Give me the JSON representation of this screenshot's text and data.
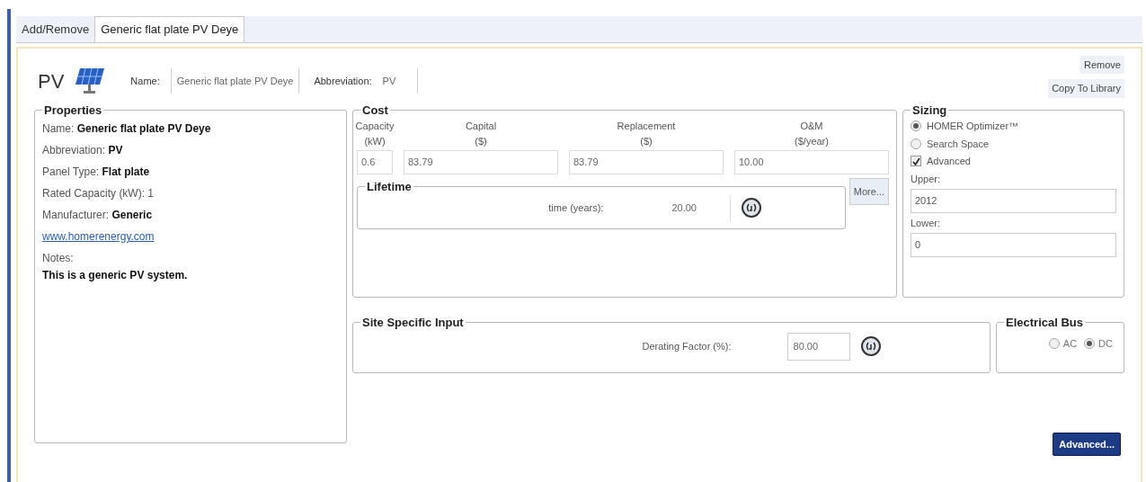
{
  "tabs": [
    {
      "label": "Add/Remove",
      "selected": false
    },
    {
      "label": "Generic flat plate PV Deye",
      "selected": true
    }
  ],
  "header": {
    "short": "PV",
    "name_label": "Name:",
    "name_value": "Generic flat plate PV Deye",
    "abbr_label": "Abbreviation:",
    "abbr_value": "PV",
    "buttons": [
      "Remove",
      "Copy To Library"
    ]
  },
  "properties": {
    "title": "Properties",
    "lines": [
      {
        "kind": "text",
        "text": "Name: **Generic flat plate PV Deye**"
      },
      {
        "kind": "text",
        "text": "Abbreviation: **PV**"
      },
      {
        "kind": "text",
        "text": "Panel Type: **Flat plate**"
      },
      {
        "kind": "text",
        "text": "Rated Capacity (kW): 1"
      },
      {
        "kind": "text",
        "text": "Manufacturer: **Generic**"
      },
      {
        "kind": "link",
        "text": "www.homerenergy.com"
      },
      {
        "kind": "text",
        "text": "Notes:"
      },
      {
        "kind": "bold",
        "text": "This is a generic PV system."
      }
    ]
  },
  "cost": {
    "title": "Cost",
    "columns": [
      {
        "label": "Capacity",
        "unit": "(kW)",
        "value": "0.6"
      },
      {
        "label": "Capital",
        "unit": "($)",
        "value": "83.79"
      },
      {
        "label": "Replacement",
        "unit": "($)",
        "value": "83.79"
      },
      {
        "label": "O&M",
        "unit": "($/year)",
        "value": "10.00"
      }
    ],
    "lifetime": {
      "title": "Lifetime",
      "label": "time (years):",
      "value": "20.00"
    },
    "more_button": "More..."
  },
  "sizing": {
    "title": "Sizing",
    "options": [
      {
        "label": "HOMER Optimizer™",
        "selected": true
      },
      {
        "label": "Search Space",
        "selected": false
      }
    ],
    "advanced": {
      "label": "Advanced",
      "checked": true
    },
    "upper_label": "Upper:",
    "upper_value": "2012",
    "lower_label": "Lower:",
    "lower_value": "0"
  },
  "site": {
    "title": "Site Specific Input",
    "label": "Derating Factor (%):",
    "value": "80.00"
  },
  "bus": {
    "title": "Electrical Bus",
    "options": [
      {
        "label": "AC",
        "selected": false
      },
      {
        "label": "DC",
        "selected": true
      }
    ]
  },
  "advanced_button": "Advanced..."
}
